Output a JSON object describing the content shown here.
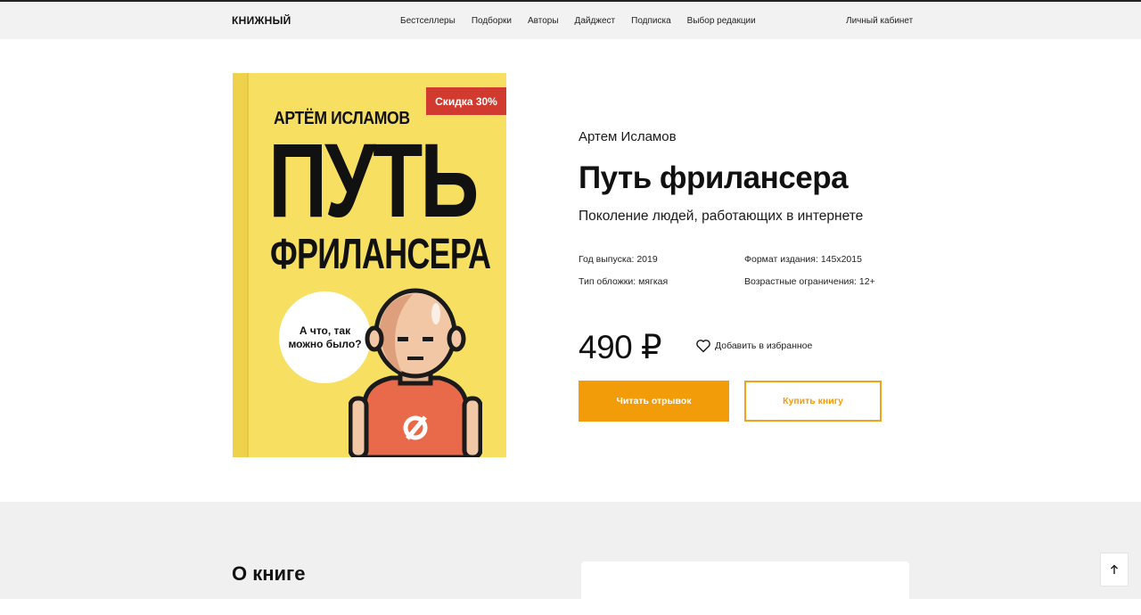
{
  "header": {
    "logo": "КНИЖНЫЙ",
    "nav": [
      "Бестселлеры",
      "Подборки",
      "Авторы",
      "Дайджест",
      "Подписка",
      "Выбор редакции"
    ],
    "account": "Личный кабинет"
  },
  "cover": {
    "author": "АРТЁМ ИСЛАМОВ",
    "title_line1": "ПУТЬ",
    "title_line2": "ФРИЛАНСЕРА",
    "bubble_text": "А что, так можно было?",
    "background_color": "#f7e061",
    "badge": "Скидка 30%",
    "badge_color": "#d13a2f"
  },
  "book": {
    "author": "Артем Исламов",
    "title": "Путь фрилансера",
    "subtitle": "Поколение людей, работающих в интернете",
    "year": "Год выпуска: 2019",
    "format": "Формат издания: 145x2015",
    "cover_type": "Тип обложки: мягкая",
    "age": "Возрастные ограничения: 12+",
    "price": "490 ₽",
    "favorite_label": "Добавить в избранное"
  },
  "actions": {
    "read_label": "Читать отрывок",
    "buy_label": "Купить книгу",
    "accent_color": "#f39c0a"
  },
  "about": {
    "heading": "О книге",
    "scroll_top_icon": "arrow-up-icon"
  }
}
